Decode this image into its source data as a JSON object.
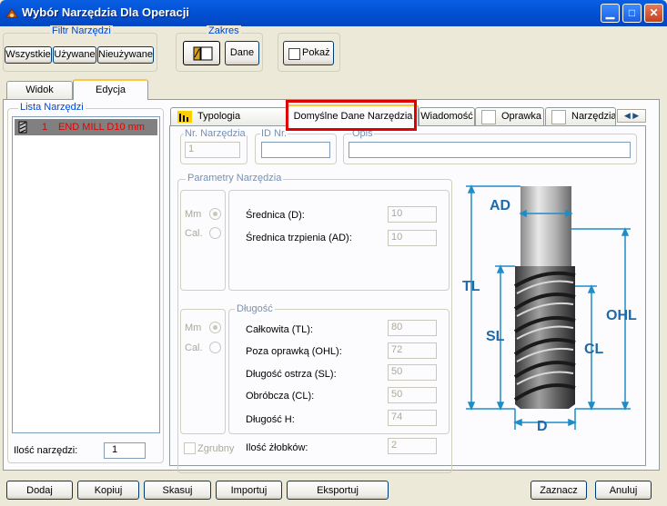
{
  "window": {
    "title": "Wybór Narzędzia Dla Operacji"
  },
  "filter": {
    "title": "Filtr Narzędzi",
    "buttons": [
      "Wszystkie",
      "Używane",
      "Nieużywane"
    ]
  },
  "range": {
    "title": "Zakres",
    "data_label": "Dane"
  },
  "show": {
    "label": "Pokaż"
  },
  "left_tabs": [
    "Widok",
    "Edycja"
  ],
  "tool_list": {
    "title": "Lista  Narzędzi",
    "items": [
      {
        "number": "1",
        "name": "END MILL  D10 mm"
      }
    ],
    "count_label": "Ilość narzędzi:",
    "count_value": "1"
  },
  "tabs": {
    "typology": "Typologia Narzędzia",
    "defaults": "Domyślne Dane Narzędzia",
    "message": "Wiadomość",
    "holder": "Oprawka",
    "tool": "Narzędzia"
  },
  "fields": {
    "nr_label": "Nr. Narzędzia",
    "nr_value": "1",
    "id_label": "ID Nr.",
    "id_value": "",
    "desc_label": "Opis",
    "desc_value": ""
  },
  "params": {
    "title": "Parametry Narzędzia",
    "unit_mm": "Mm",
    "unit_cal": "Cal.",
    "diameter_label": "Średnica (D):",
    "diameter_value": "10",
    "shank_label": "Średnica trzpienia (AD):",
    "shank_value": "10"
  },
  "length": {
    "title": "Długość",
    "unit_mm": "Mm",
    "unit_cal": "Cal.",
    "rows": [
      {
        "label": "Całkowita (TL):",
        "value": "80"
      },
      {
        "label": "Poza oprawką (OHL):",
        "value": "72"
      },
      {
        "label": "Długość ostrza (SL):",
        "value": "50"
      },
      {
        "label": "Obróbcza (CL):",
        "value": "50"
      },
      {
        "label": "Długość H:",
        "value": "74"
      }
    ],
    "rough_label": "Zgrubny",
    "flutes_label": "Ilość żłobków:",
    "flutes_value": "2"
  },
  "diagram": {
    "AD": "AD",
    "TL": "TL",
    "SL": "SL",
    "OHL": "OHL",
    "CL": "CL",
    "D": "D"
  },
  "bottom_buttons": {
    "add": "Dodaj",
    "copy": "Kopiuj",
    "delete": "Skasuj",
    "import": "Importuj",
    "export": "Eksportuj",
    "select": "Zaznacz",
    "cancel": "Anuluj"
  },
  "colors": {
    "titlebar": "#0353d6",
    "highlight": "#e00000",
    "group_title": "#0046d5",
    "list_selected": "#808080"
  }
}
